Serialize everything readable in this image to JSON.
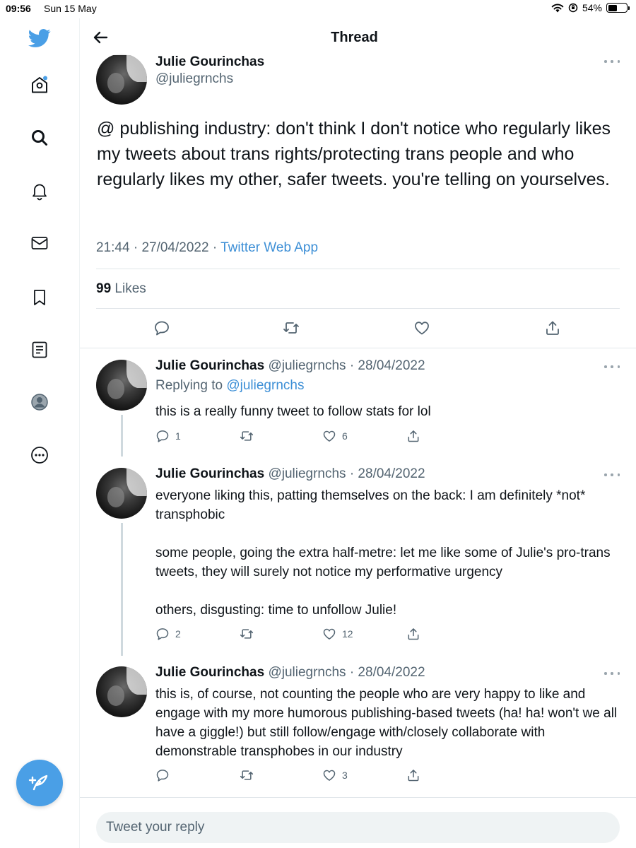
{
  "status_bar": {
    "time": "09:56",
    "date": "Sun 15 May",
    "battery": "54%",
    "battery_level": 0.54
  },
  "sidebar": {
    "items": [
      {
        "name": "home",
        "icon": "home-icon",
        "notification_dot": true
      },
      {
        "name": "explore",
        "icon": "search-icon"
      },
      {
        "name": "notifications",
        "icon": "bell-icon"
      },
      {
        "name": "messages",
        "icon": "mail-icon"
      },
      {
        "name": "bookmarks",
        "icon": "bookmark-icon"
      },
      {
        "name": "lists",
        "icon": "list-icon"
      },
      {
        "name": "profile",
        "icon": "profile-icon"
      },
      {
        "name": "more",
        "icon": "more-icon"
      }
    ],
    "compose_icon": "compose-tweet-icon"
  },
  "header": {
    "title": "Thread"
  },
  "main_tweet": {
    "name": "Julie Gourinchas",
    "handle": "@juliegrnchs",
    "text": "@ publishing industry: don't think I don't notice who regularly likes my tweets about trans rights/protecting trans people and who regularly likes my other, safer tweets. you're telling on yourselves.",
    "time": "21:44",
    "date": "27/04/2022",
    "separator": "·",
    "source": "Twitter Web App",
    "likes_count": "99",
    "likes_label": "Likes"
  },
  "replies": [
    {
      "name": "Julie Gourinchas",
      "handle_date": "@juliegrnchs · 28/04/2022",
      "replying_prefix": "Replying to",
      "replying_handle": "@juliegrnchs",
      "paragraphs": [
        "this is a really funny tweet to follow stats for lol"
      ],
      "reply_count": "1",
      "retweet_count": "",
      "like_count": "6"
    },
    {
      "name": "Julie Gourinchas",
      "handle_date": "@juliegrnchs · 28/04/2022",
      "paragraphs": [
        "everyone liking this, patting themselves on the back: I am definitely *not* transphobic",
        "",
        "some people, going the extra half-metre: let me like some of Julie's pro-trans tweets, they will surely not notice my performative urgency",
        "",
        "others, disgusting: time to unfollow Julie!"
      ],
      "reply_count": "2",
      "retweet_count": "",
      "like_count": "12"
    },
    {
      "name": "Julie Gourinchas",
      "handle_date": "@juliegrnchs · 28/04/2022",
      "paragraphs": [
        "this is, of course, not counting the people who are very happy to like and engage with my more humorous publishing-based tweets (ha! ha! won't we all have a giggle!) but still follow/engage with/closely collaborate with demonstrable transphobes in our industry"
      ],
      "reply_count": "",
      "retweet_count": "",
      "like_count": "3"
    }
  ],
  "reply_bar": {
    "placeholder": "Tweet your reply"
  },
  "colors": {
    "accent": "#4a9fe6",
    "link": "#3d8fd6",
    "secondary_text": "#536471"
  }
}
